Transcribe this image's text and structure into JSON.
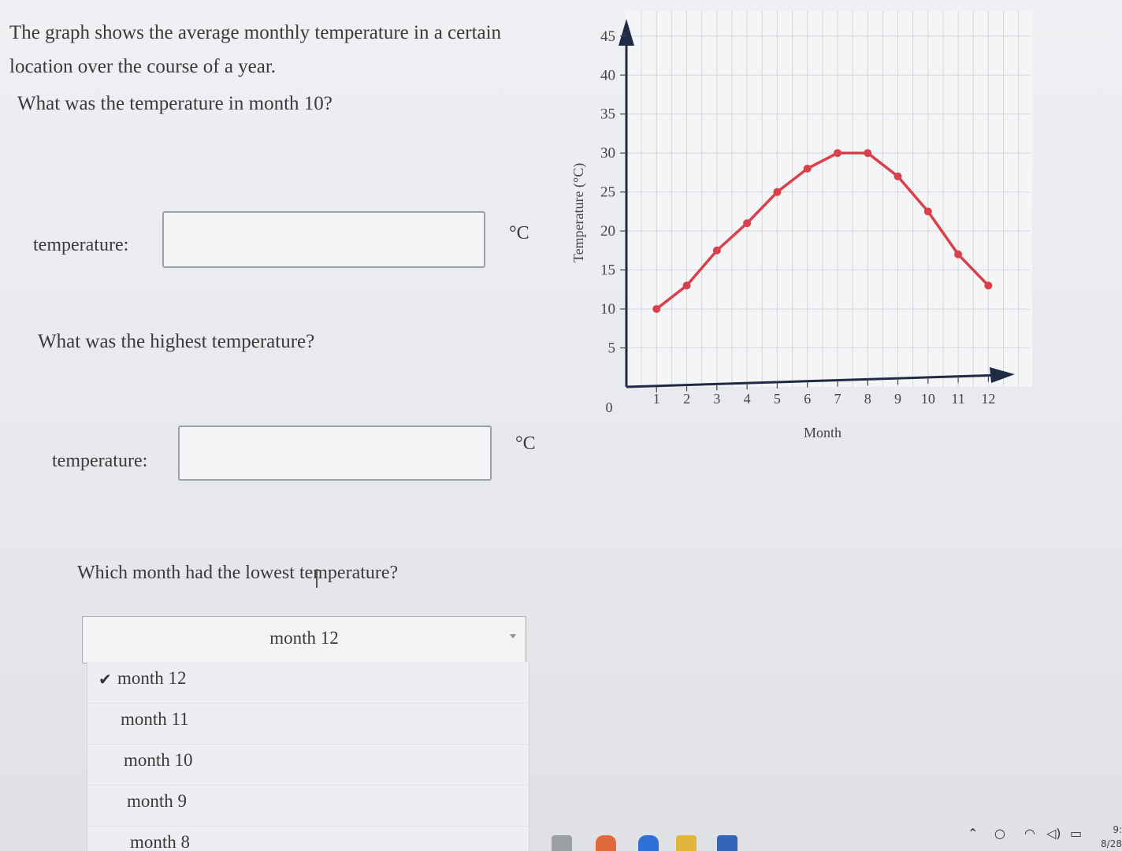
{
  "intro": {
    "line1": "The graph shows the average monthly temperature in a certain",
    "line2": "location over the course of a year."
  },
  "question1": {
    "text": "What was the temperature in month 10?",
    "label": "temperature:",
    "value": "",
    "unit": "°C"
  },
  "question2": {
    "text": "What was the highest temperature?",
    "label": "temperature:",
    "value": "",
    "unit": "°C"
  },
  "question3": {
    "text": "Which month had the lowest temperature?",
    "selected": "month 12",
    "options": [
      "month 12",
      "month 11",
      "month 10",
      "month 9",
      "month 8"
    ],
    "checked_index": 0
  },
  "chart_data": {
    "type": "line",
    "title": "",
    "xlabel": "Month",
    "ylabel": "Temperature (°C)",
    "x": [
      1,
      2,
      3,
      4,
      5,
      6,
      7,
      8,
      9,
      10,
      11,
      12
    ],
    "series": [
      {
        "values": [
          10,
          13,
          17.5,
          21,
          25,
          28,
          30,
          30,
          27,
          22.5,
          17,
          13
        ],
        "color": "#d9404a"
      }
    ],
    "x_ticks": [
      "1",
      "2",
      "3",
      "4",
      "5",
      "6",
      "7",
      "8",
      "9",
      "10",
      "11",
      "12"
    ],
    "y_ticks": [
      "5",
      "10",
      "15",
      "20",
      "25",
      "30",
      "35",
      "40",
      "45"
    ],
    "origin_label": "0",
    "xlim": [
      0,
      12.8
    ],
    "ylim": [
      0,
      47
    ],
    "grid": true
  },
  "tray": {
    "time": "9:",
    "date": "8/28"
  }
}
